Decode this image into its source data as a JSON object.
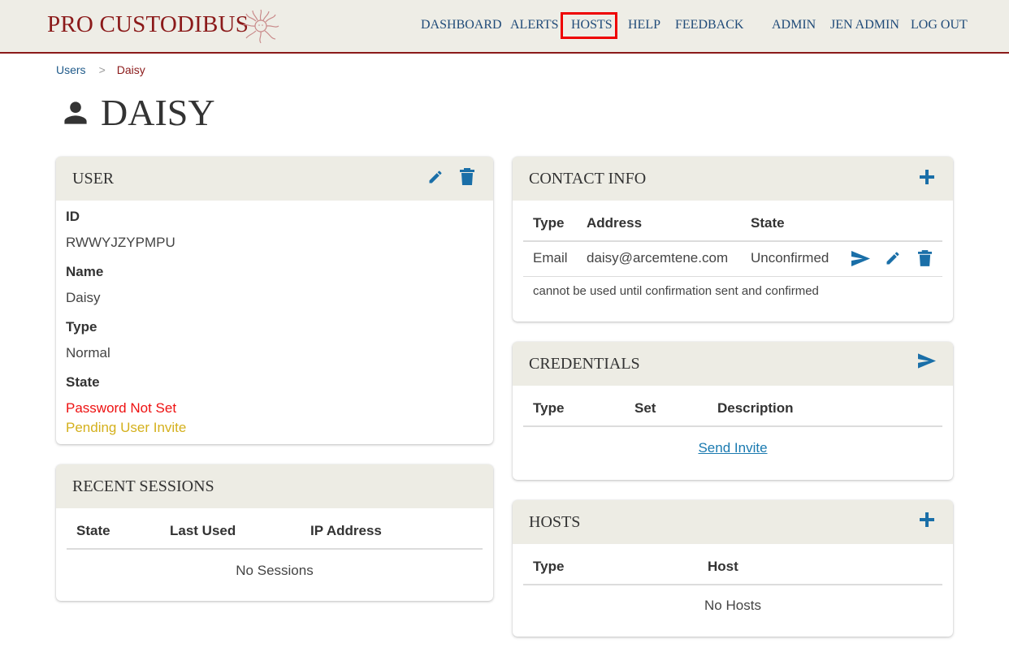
{
  "brand": {
    "name": "PRO CUSTODIBUS",
    "logo_icon": "medusa-logo-icon"
  },
  "nav": {
    "items": [
      {
        "label": "DASHBOARD"
      },
      {
        "label": "ALERTS"
      },
      {
        "label": "HOSTS",
        "highlighted": true
      },
      {
        "label": "HELP"
      },
      {
        "label": "FEEDBACK"
      },
      {
        "label": "ADMIN"
      },
      {
        "label": "JEN ADMIN"
      },
      {
        "label": "LOG OUT"
      }
    ]
  },
  "breadcrumb": {
    "parent": "Users",
    "separator": ">",
    "current": "Daisy"
  },
  "page": {
    "title": "DAISY",
    "icon": "person-icon"
  },
  "user_card": {
    "title": "USER",
    "fields": {
      "id_label": "ID",
      "id_value": "RWWYJZYPMPU",
      "name_label": "Name",
      "name_value": "Daisy",
      "type_label": "Type",
      "type_value": "Normal",
      "state_label": "State",
      "state_values": [
        "Password Not Set",
        "Pending User Invite"
      ]
    }
  },
  "sessions_card": {
    "title": "RECENT SESSIONS",
    "columns": [
      "State",
      "Last Used",
      "IP Address"
    ],
    "empty": "No Sessions"
  },
  "contact_card": {
    "title": "CONTACT INFO",
    "columns": [
      "Type",
      "Address",
      "State"
    ],
    "rows": [
      {
        "type": "Email",
        "address": "daisy@arcemtene.com",
        "state": "Unconfirmed"
      }
    ],
    "note": "cannot be used until confirmation sent and confirmed"
  },
  "credentials_card": {
    "title": "CREDENTIALS",
    "columns": [
      "Type",
      "Set",
      "Description"
    ],
    "action_link": "Send Invite"
  },
  "hosts_card": {
    "title": "HOSTS",
    "columns": [
      "Type",
      "Host"
    ],
    "empty": "No Hosts"
  },
  "colors": {
    "brand": "#8b1a1a",
    "nav": "#1f4a78",
    "action_icon": "#1a6fa8",
    "error": "#ee1111",
    "warning": "#d4b01c",
    "header_bg": "#eeede6"
  }
}
